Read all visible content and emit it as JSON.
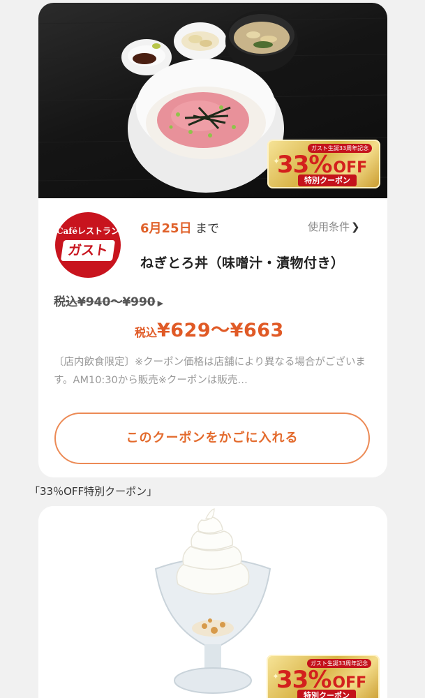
{
  "coupon1": {
    "badge": {
      "top_text": "ガスト生誕33周年記念",
      "percent": "33%",
      "off": "OFF",
      "sub": "特別クーポン"
    },
    "logo": {
      "top": "Caféレストラン",
      "name": "ガスト"
    },
    "deadline_date": "6月25日",
    "deadline_suffix": "まで",
    "terms_label": "使用条件",
    "item_name": "ねぎとろ丼（味噌汁・漬物付き）",
    "old_price": "税込¥940〜¥990",
    "new_price_tax": "税込",
    "new_price_amount": "¥629〜¥663",
    "notes": "〔店内飲食限定〕※クーポン価格は店舗により異なる場合がございます。AM10:30から販売※クーポンは販売…",
    "cart_button": "このクーポンをかごに入れる"
  },
  "section_label": "「33％OFF特別クーポン」",
  "coupon2": {
    "badge": {
      "top_text": "ガスト生誕33周年記念",
      "percent": "33%",
      "off": "OFF",
      "sub": "特別クーポン"
    }
  },
  "colors": {
    "accent_orange": "#e05a26",
    "brand_red": "#c8141e",
    "badge_gold": "#d9b447"
  }
}
